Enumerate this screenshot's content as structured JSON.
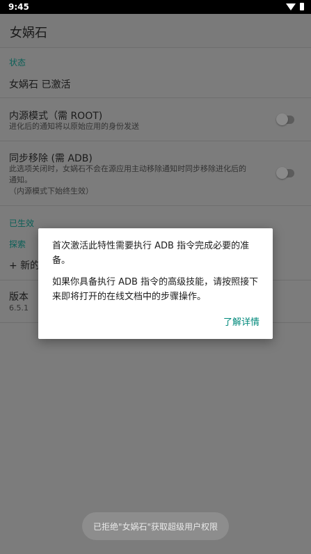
{
  "status_bar": {
    "time": "9:45",
    "icons": [
      "wifi-icon",
      "battery-icon"
    ]
  },
  "app_bar": {
    "title": "女娲石"
  },
  "sections": {
    "status": {
      "category": "状态",
      "activated_text": "女娲石 已激活"
    },
    "inner_source": {
      "title": "内源模式（需 ROOT)",
      "summary": "进化后的通知将以原始应用的身份发送",
      "enabled": false
    },
    "sync_remove": {
      "title": "同步移除 (需 ADB)",
      "summary_lines": [
        "此选项关闭时，女娲石不会在源应用主动移除通知时同步移除进化后的",
        "通知。",
        "（内源模式下始终生效）"
      ],
      "enabled": false
    },
    "effective": {
      "category": "已生效"
    },
    "explore": {
      "category": "探索",
      "add_label": "+ 新的"
    },
    "version": {
      "title": "版本",
      "value": "6.5.1"
    }
  },
  "dialog": {
    "message_1_lines": [
      "首次激活此特性需要执行 ADB 指令完成必要的准",
      "备。"
    ],
    "message_2_lines": [
      "如果你具备执行 ADB 指令的高级技能，请按照接下",
      "来即将打开的在线文档中的步骤操作。"
    ],
    "button": "了解详情",
    "accent_color": "#00897b"
  },
  "toast": {
    "text": "已拒绝\"女娲石\"获取超级用户权限"
  }
}
